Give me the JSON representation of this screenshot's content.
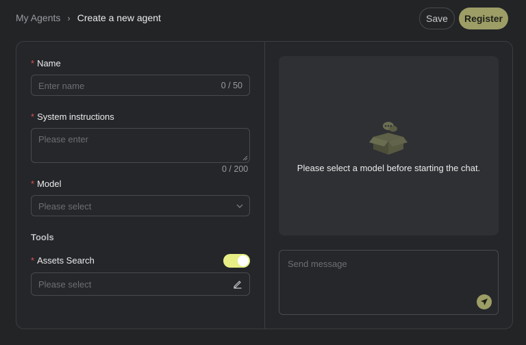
{
  "breadcrumb": {
    "root": "My Agents",
    "separator": "›",
    "current": "Create a new agent"
  },
  "actions": {
    "save_label": "Save",
    "register_label": "Register"
  },
  "form": {
    "required_mark": "*",
    "name": {
      "label": "Name",
      "placeholder": "Enter name",
      "counter": "0 / 50"
    },
    "instructions": {
      "label": "System instructions",
      "placeholder": "Please enter",
      "counter": "0 / 200"
    },
    "model": {
      "label": "Model",
      "placeholder": "Please select"
    },
    "tools": {
      "heading": "Tools",
      "assets_search": {
        "label": "Assets Search",
        "enabled": true,
        "placeholder": "Please select"
      }
    }
  },
  "chat": {
    "empty_message": "Please select a model before starting the chat.",
    "input_placeholder": "Send message"
  },
  "icons": {
    "crumb_separator": "chevron-right-icon",
    "model_dropdown": "chevron-down-icon",
    "assets_edit": "pencil-icon",
    "empty_state": "box-chat-icon",
    "send": "send-icon"
  },
  "colors": {
    "accent": "#9c9e66",
    "toggle_on": "#e7ee86",
    "required": "#d9534f",
    "background": "#232426"
  }
}
